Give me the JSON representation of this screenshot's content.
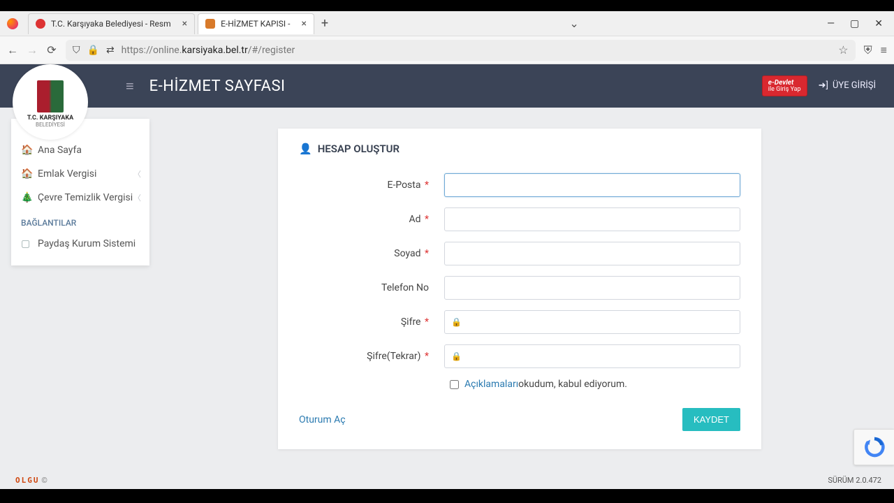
{
  "browser": {
    "tabs": [
      {
        "title": "T.C. Karşıyaka Belediyesi - Resm"
      },
      {
        "title": "E-HİZMET KAPISI -"
      }
    ],
    "url_prefix": "https://online.",
    "url_host": "karsiyaka.bel.tr",
    "url_path": "/#/register"
  },
  "header": {
    "title": "E-HİZMET SAYFASI",
    "edevlet_l1": "e-Devlet",
    "edevlet_l2": "ile Giriş Yap",
    "member_login": "ÜYE GİRİŞİ"
  },
  "logo": {
    "line1": "T.C. KARŞIYAKA",
    "line2": "BELEDİYESİ"
  },
  "sidebar": {
    "items": [
      {
        "label": "Ana Sayfa",
        "icon": "🏠",
        "chev": false
      },
      {
        "label": "Emlak Vergisi",
        "icon": "🏠",
        "chev": true
      },
      {
        "label": "Çevre Temizlik Vergisi",
        "icon": "🎄",
        "chev": true
      }
    ],
    "section": "BAĞLANTILAR",
    "links": [
      {
        "label": "Paydaş Kurum Sistemi",
        "icon": "▢"
      }
    ]
  },
  "card": {
    "title": "HESAP OLUŞTUR",
    "fields": {
      "email_label": "E-Posta",
      "name_label": "Ad",
      "surname_label": "Soyad",
      "phone_label": "Telefon No",
      "password_label": "Şifre",
      "password2_label": "Şifre(Tekrar)"
    },
    "required_mark": "*",
    "agree_link": "Açıklamaları",
    "agree_rest": " okudum, kabul ediyorum.",
    "login_link": "Oturum Aç",
    "save_button": "KAYDET"
  },
  "footer": {
    "brand": "OLGU",
    "copyright": "©",
    "version_label": "SÜRÜM ",
    "version": "2.0.472"
  }
}
